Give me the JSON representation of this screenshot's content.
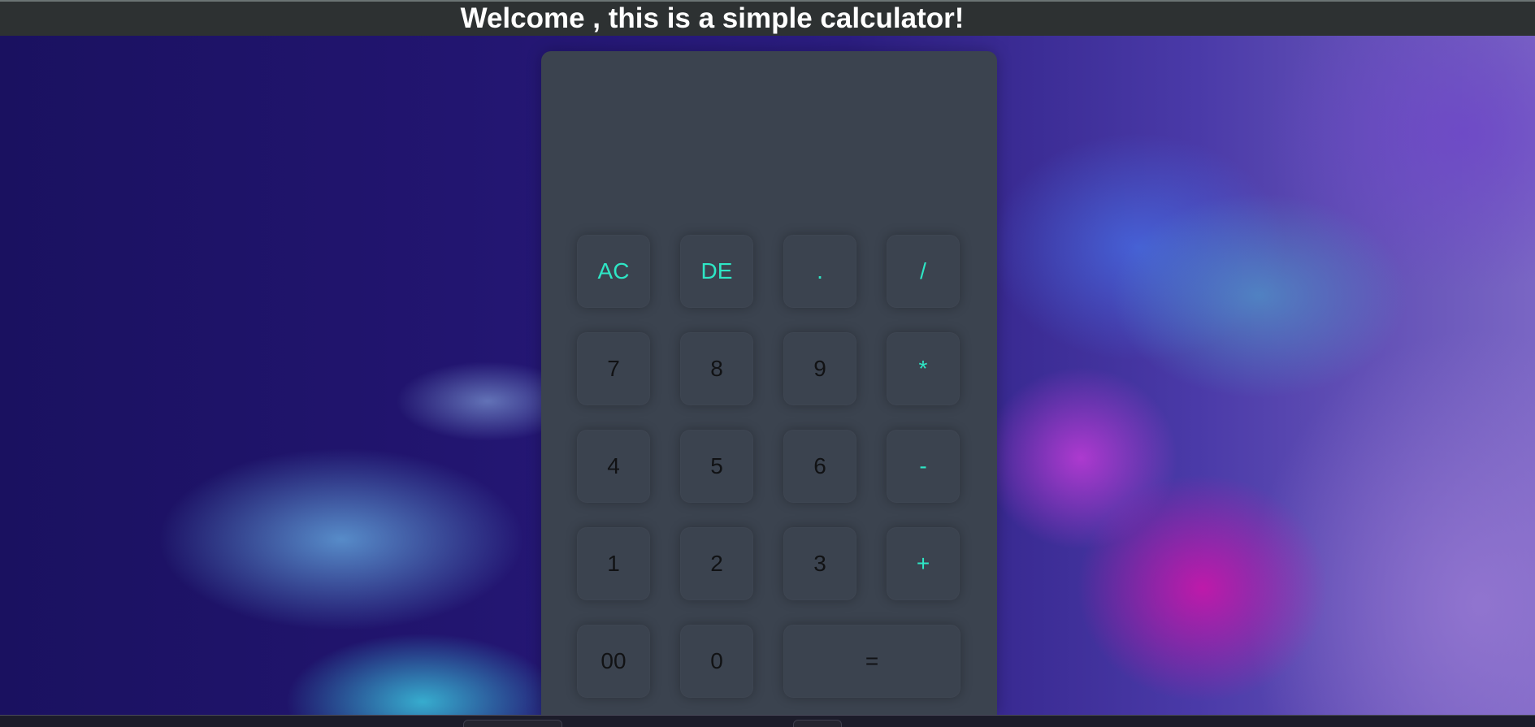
{
  "header": {
    "title": "Welcome , this is a simple calculator!"
  },
  "calculator": {
    "display_value": "",
    "keys": [
      {
        "label": "AC",
        "name": "all-clear-button",
        "accent": true
      },
      {
        "label": "DE",
        "name": "delete-button",
        "accent": true
      },
      {
        "label": ".",
        "name": "decimal-point-button",
        "accent": true
      },
      {
        "label": "/",
        "name": "divide-button",
        "accent": true
      },
      {
        "label": "7",
        "name": "digit-7-button",
        "accent": false
      },
      {
        "label": "8",
        "name": "digit-8-button",
        "accent": false
      },
      {
        "label": "9",
        "name": "digit-9-button",
        "accent": false
      },
      {
        "label": "*",
        "name": "multiply-button",
        "accent": true
      },
      {
        "label": "4",
        "name": "digit-4-button",
        "accent": false
      },
      {
        "label": "5",
        "name": "digit-5-button",
        "accent": false
      },
      {
        "label": "6",
        "name": "digit-6-button",
        "accent": false
      },
      {
        "label": "-",
        "name": "subtract-button",
        "accent": true
      },
      {
        "label": "1",
        "name": "digit-1-button",
        "accent": false
      },
      {
        "label": "2",
        "name": "digit-2-button",
        "accent": false
      },
      {
        "label": "3",
        "name": "digit-3-button",
        "accent": false
      },
      {
        "label": "+",
        "name": "add-button",
        "accent": true
      },
      {
        "label": "00",
        "name": "double-zero-button",
        "accent": false
      },
      {
        "label": "0",
        "name": "digit-0-button",
        "accent": false
      },
      {
        "label": "=",
        "name": "equals-button",
        "accent": false
      }
    ]
  },
  "colors": {
    "header_background": "#2d3132",
    "calculator_body": "#3b434f",
    "accent_text": "#2ee6c5",
    "digit_text": "#111214"
  }
}
